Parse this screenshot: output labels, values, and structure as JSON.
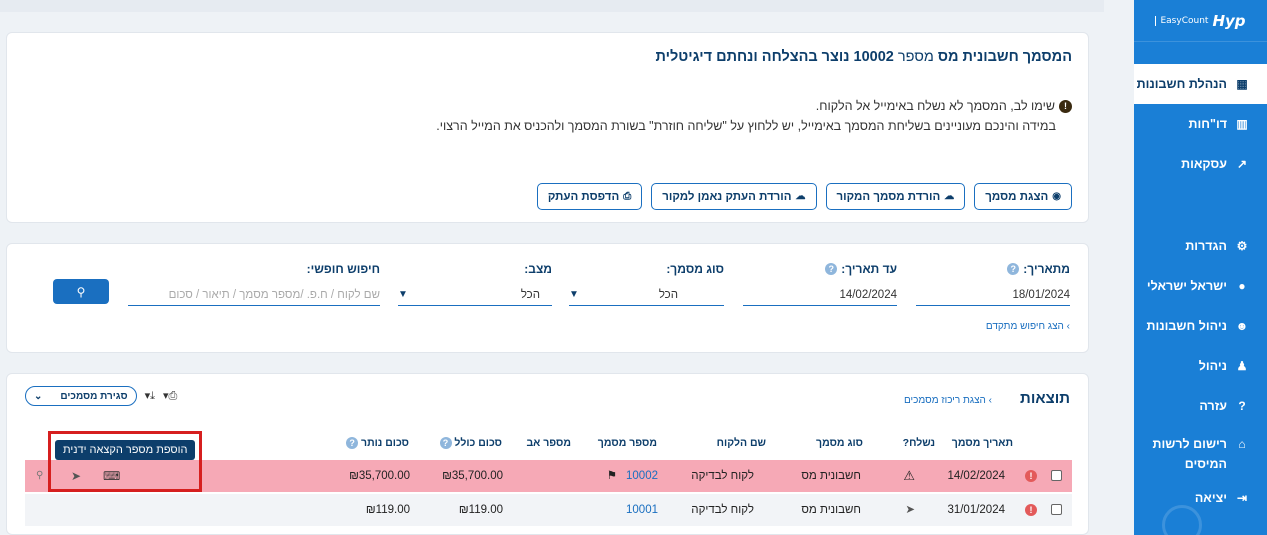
{
  "sidebar": {
    "logo_brand": "Hyp",
    "logo_sub": "EasyCount",
    "items": [
      {
        "label": "הנהלת חשבונות",
        "icon": "calculator-icon",
        "glyph": "▦"
      },
      {
        "label": "דו\"חות",
        "icon": "bar-chart-icon",
        "glyph": "▥"
      },
      {
        "label": "עסקאות",
        "icon": "line-chart-icon",
        "glyph": "↗"
      },
      {
        "label": "הגדרות",
        "icon": "gear-icon",
        "glyph": "⚙"
      },
      {
        "label": "ישראל ישראלי",
        "icon": "user-circle-icon",
        "glyph": "●"
      },
      {
        "label": "ניהול חשבונות",
        "icon": "users-icon",
        "glyph": "☻"
      },
      {
        "label": "ניהול",
        "icon": "user-icon",
        "glyph": "♟"
      },
      {
        "label": "עזרה",
        "icon": "help-icon",
        "glyph": "?"
      },
      {
        "label": "רישום לרשות המיסים",
        "icon": "bank-icon",
        "glyph": "⌂"
      },
      {
        "label": "יציאה",
        "icon": "logout-icon",
        "glyph": "⇥"
      }
    ]
  },
  "message": {
    "title_prefix": "המסמך ",
    "title_doc_type": "חשבונית מס",
    "title_middle": " מספר ",
    "title_doc_number": "10002",
    "title_suffix": " נוצר בהצלחה ונחתם דיגיטלית",
    "warning": "שימו לב, המסמך לא נשלח באימייל אל הלקוח.",
    "instructions": "במידה והינכם מעוניינים בשליחת המסמך באימייל, יש ללחוץ על \"שליחה חוזרת\" בשורת המסמך ולהכניס את המייל הרצוי."
  },
  "actions": {
    "show_doc": "הצגת מסמך",
    "download_original": "הורדת מסמך המקור",
    "download_copy": "הורדת העתק נאמן למקור",
    "print_copy": "הדפסת העתק"
  },
  "filters": {
    "from_date_label": "מתאריך:",
    "from_date_value": "18/01/2024",
    "to_date_label": "עד תאריך:",
    "to_date_value": "14/02/2024",
    "doc_type_label": "סוג מסמך:",
    "doc_type_value": "הכל",
    "status_label": "מצב:",
    "status_value": "הכל",
    "free_search_label": "חיפוש חופשי:",
    "free_search_placeholder": "שם לקוח / ח.פ. /מספר מסמך / תיאור / סכום",
    "advanced_search": "הצג חיפוש מתקדם"
  },
  "results": {
    "title": "תוצאות",
    "summary_link": "הצגת ריכוז מסמכים",
    "filter_dropdown": "סגירת מסמכים",
    "columns": [
      "תאריך מסמך",
      "נשלח?",
      "סוג מסמך",
      "שם הלקוח",
      "מספר מסמך",
      "מספר אב",
      "סכום כולל",
      "סכום נותר"
    ],
    "rows": [
      {
        "date": "14/02/2024",
        "sent": "⚠",
        "type": "חשבונית מס",
        "client": "לקוח לבדיקה",
        "number": "10002",
        "parent": "",
        "total": "₪35,700.00",
        "remaining": "₪35,700.00"
      },
      {
        "date": "31/01/2024",
        "sent": "➤",
        "type": "חשבונית מס",
        "client": "לקוח לבדיקה",
        "number": "10001",
        "parent": "",
        "total": "₪119.00",
        "remaining": "₪119.00"
      }
    ],
    "tooltip": "הוספת מספר הקצאה ידנית"
  },
  "colors": {
    "brand_blue": "#1a7fd6",
    "highlight_row": "#f6a9b6",
    "annotation_red": "#d61f1f"
  }
}
